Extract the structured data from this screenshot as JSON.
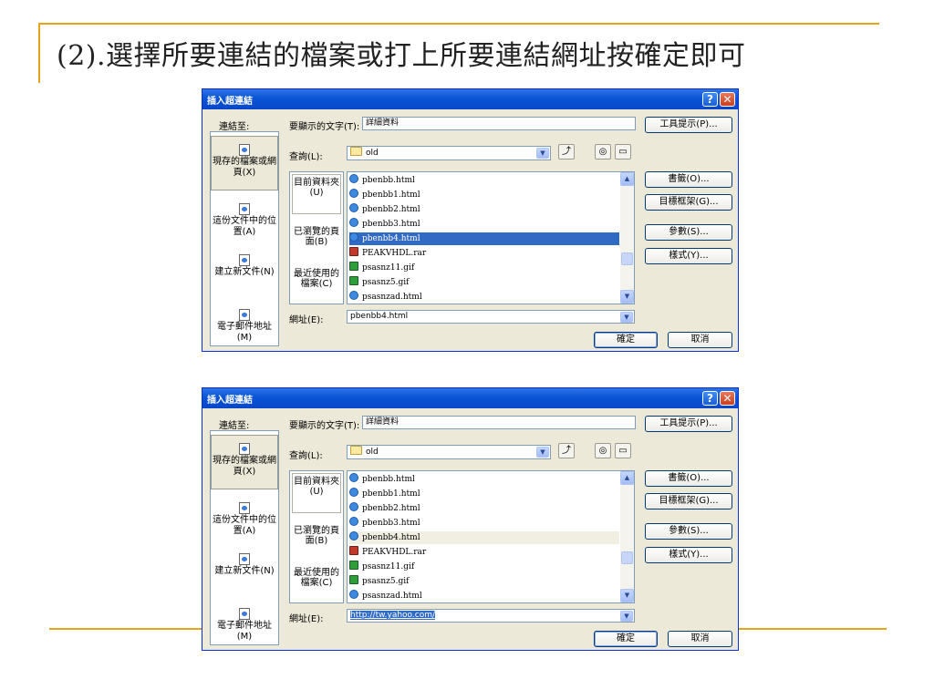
{
  "slide": {
    "title": "(2).選擇所要連結的檔案或打上所要連結網址按確定即可"
  },
  "colors": {
    "accent_rule": "#e8a319",
    "titlebar": "#0a55d6",
    "selection": "#316ac5"
  },
  "dialogs": [
    {
      "title": "插入超連結",
      "link_to_label": "連結至:",
      "display_text_label": "要顯示的文字(T):",
      "display_text_value": "詳細資料",
      "screentip_button": "工具提示(P)...",
      "look_in_label": "查詢(L):",
      "look_in_value": "old",
      "sidebar_items": [
        {
          "label": "現存的檔案或網頁(X)",
          "icon": "web-page-icon"
        },
        {
          "label": "這份文件中的位置(A)",
          "icon": "document-place-icon"
        },
        {
          "label": "建立新文件(N)",
          "icon": "new-document-icon"
        },
        {
          "label": "電子郵件地址(M)",
          "icon": "email-icon"
        }
      ],
      "browse_items": [
        "目前資料夾(U)",
        "已瀏覽的頁面(B)",
        "最近使用的檔案(C)"
      ],
      "files": [
        {
          "name": "pbenbb.html",
          "type": "html"
        },
        {
          "name": "pbenbb1.html",
          "type": "html"
        },
        {
          "name": "pbenbb2.html",
          "type": "html"
        },
        {
          "name": "pbenbb3.html",
          "type": "html"
        },
        {
          "name": "pbenbb4.html",
          "type": "html"
        },
        {
          "name": "PEAKVHDL.rar",
          "type": "rar"
        },
        {
          "name": "psasnz11.gif",
          "type": "gif"
        },
        {
          "name": "psasnz5.gif",
          "type": "gif"
        },
        {
          "name": "psasnzad.html",
          "type": "html"
        }
      ],
      "selected_file_index": 4,
      "side_buttons": [
        "書籤(O)...",
        "目標框架(G)...",
        "參數(S)...",
        "樣式(Y)..."
      ],
      "address_label": "網址(E):",
      "address_value": "pbenbb4.html",
      "ok_button": "確定",
      "cancel_button": "取消"
    },
    {
      "title": "插入超連結",
      "link_to_label": "連結至:",
      "display_text_label": "要顯示的文字(T):",
      "display_text_value": "詳細資料",
      "screentip_button": "工具提示(P)...",
      "look_in_label": "查詢(L):",
      "look_in_value": "old",
      "sidebar_items": [
        {
          "label": "現存的檔案或網頁(X)",
          "icon": "web-page-icon"
        },
        {
          "label": "這份文件中的位置(A)",
          "icon": "document-place-icon"
        },
        {
          "label": "建立新文件(N)",
          "icon": "new-document-icon"
        },
        {
          "label": "電子郵件地址(M)",
          "icon": "email-icon"
        }
      ],
      "browse_items": [
        "目前資料夾(U)",
        "已瀏覽的頁面(B)",
        "最近使用的檔案(C)"
      ],
      "files": [
        {
          "name": "pbenbb.html",
          "type": "html"
        },
        {
          "name": "pbenbb1.html",
          "type": "html"
        },
        {
          "name": "pbenbb2.html",
          "type": "html"
        },
        {
          "name": "pbenbb3.html",
          "type": "html"
        },
        {
          "name": "pbenbb4.html",
          "type": "html"
        },
        {
          "name": "PEAKVHDL.rar",
          "type": "rar"
        },
        {
          "name": "psasnz11.gif",
          "type": "gif"
        },
        {
          "name": "psasnz5.gif",
          "type": "gif"
        },
        {
          "name": "psasnzad.html",
          "type": "html"
        }
      ],
      "selected_file_index": -1,
      "side_buttons": [
        "書籤(O)...",
        "目標框架(G)...",
        "參數(S)...",
        "樣式(Y)..."
      ],
      "address_label": "網址(E):",
      "address_value": "http://tw.yahoo.com/",
      "ok_button": "確定",
      "cancel_button": "取消"
    }
  ]
}
